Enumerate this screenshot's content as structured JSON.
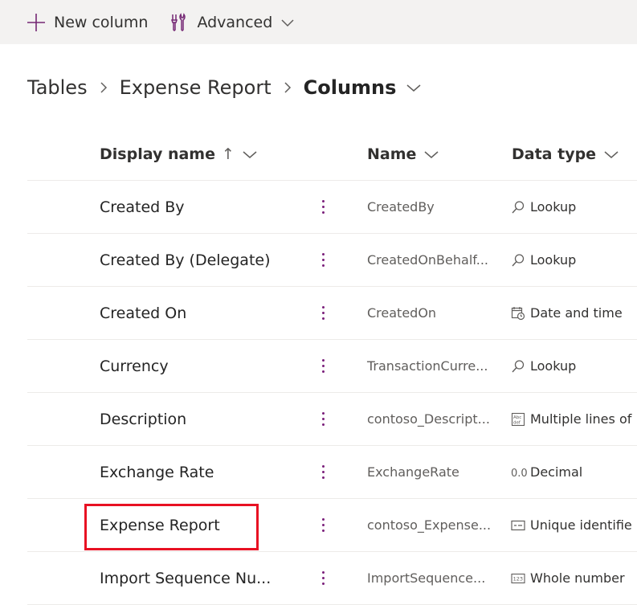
{
  "toolbar": {
    "new_column_label": "New column",
    "advanced_label": "Advanced"
  },
  "breadcrumb": {
    "items": [
      "Tables",
      "Expense Report"
    ],
    "current": "Columns"
  },
  "table": {
    "headers": {
      "display_name": "Display name",
      "name": "Name",
      "data_type": "Data type"
    },
    "sort_indicator": "↑",
    "rows": [
      {
        "display_name": "Created By",
        "name": "CreatedBy",
        "data_type": "Lookup",
        "type_icon": "lookup-icon"
      },
      {
        "display_name": "Created By (Delegate)",
        "name": "CreatedOnBehalf...",
        "data_type": "Lookup",
        "type_icon": "lookup-icon"
      },
      {
        "display_name": "Created On",
        "name": "CreatedOn",
        "data_type": "Date and time",
        "type_icon": "calendar-clock-icon"
      },
      {
        "display_name": "Currency",
        "name": "TransactionCurre...",
        "data_type": "Lookup",
        "type_icon": "lookup-icon"
      },
      {
        "display_name": "Description",
        "name": "contoso_Descript...",
        "data_type": "Multiple lines of",
        "type_icon": "text-lines-icon"
      },
      {
        "display_name": "Exchange Rate",
        "name": "ExchangeRate",
        "data_type": "Decimal",
        "type_icon": "decimal-icon"
      },
      {
        "display_name": "Expense Report",
        "name": "contoso_Expense...",
        "data_type": "Unique identifie",
        "type_icon": "id-card-icon"
      },
      {
        "display_name": "Import Sequence Nu...",
        "name": "ImportSequence...",
        "data_type": "Whole number",
        "type_icon": "whole-number-icon"
      }
    ]
  },
  "colors": {
    "accent": "#742774",
    "highlight_box": "#e81123"
  }
}
